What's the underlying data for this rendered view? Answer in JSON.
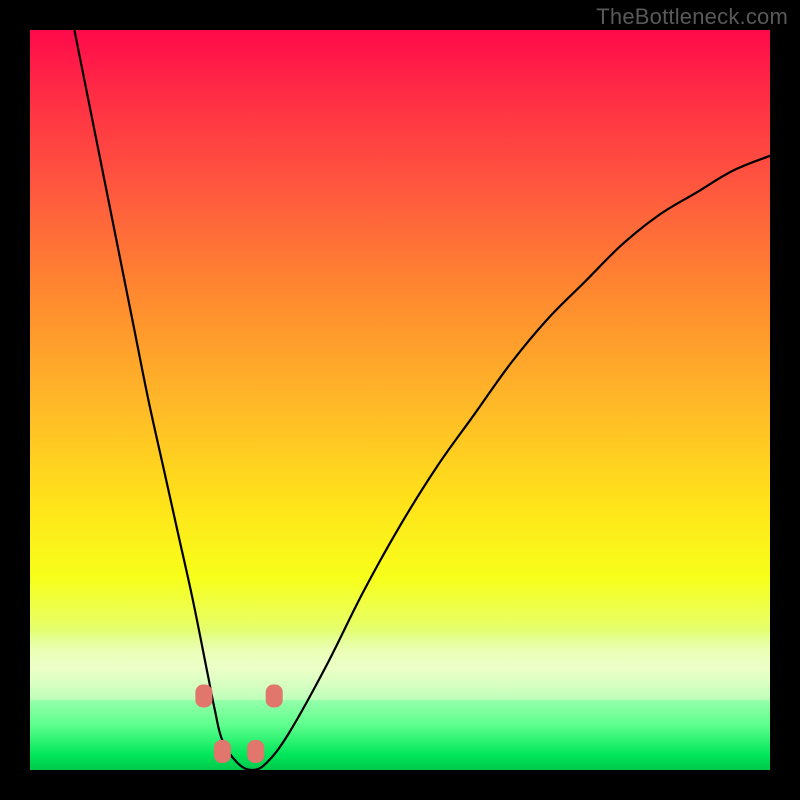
{
  "watermark": "TheBottleneck.com",
  "chart_data": {
    "type": "line",
    "title": "",
    "xlabel": "",
    "ylabel": "",
    "xlim": [
      0,
      100
    ],
    "ylim": [
      0,
      100
    ],
    "grid": false,
    "legend": false,
    "series": [
      {
        "name": "bottleneck-curve",
        "x": [
          6,
          8,
          10,
          12,
          14,
          16,
          18,
          20,
          22,
          24,
          25,
          26,
          28,
          30,
          32,
          35,
          40,
          45,
          50,
          55,
          60,
          65,
          70,
          75,
          80,
          85,
          90,
          95,
          100
        ],
        "y": [
          100,
          90,
          80,
          70,
          60,
          50,
          41,
          32,
          23,
          13,
          8,
          4,
          1,
          0,
          1,
          5,
          14,
          24,
          33,
          41,
          48,
          55,
          61,
          66,
          71,
          75,
          78,
          81,
          83
        ]
      }
    ],
    "markers": [
      {
        "name": "marker-left-upper",
        "x": 23.5,
        "y": 10
      },
      {
        "name": "marker-right-upper",
        "x": 33.0,
        "y": 10
      },
      {
        "name": "marker-left-lower",
        "x": 26.0,
        "y": 2.5
      },
      {
        "name": "marker-right-lower",
        "x": 30.5,
        "y": 2.5
      }
    ],
    "colors": {
      "curve": "#000000",
      "marker": "#e0766c"
    }
  }
}
